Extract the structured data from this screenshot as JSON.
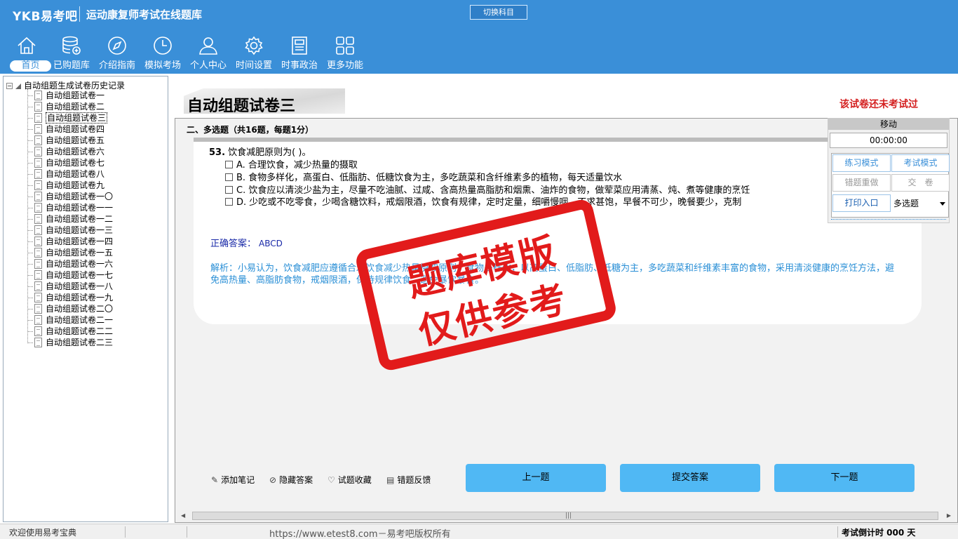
{
  "app": {
    "brand": "YKB易考吧",
    "title": "运动康复师考试在线题库",
    "switch_subject": "切换科目"
  },
  "nav": [
    {
      "label": "首页",
      "icon": "home-icon",
      "active": true
    },
    {
      "label": "已购题库",
      "icon": "database-add-icon"
    },
    {
      "label": "介绍指南",
      "icon": "compass-icon"
    },
    {
      "label": "模拟考场",
      "icon": "clock-icon"
    },
    {
      "label": "个人中心",
      "icon": "user-icon"
    },
    {
      "label": "时间设置",
      "icon": "gear-icon"
    },
    {
      "label": "时事政治",
      "icon": "newspaper-icon"
    },
    {
      "label": "更多功能",
      "icon": "grid-icon"
    }
  ],
  "tree": {
    "root": "自动组题生成试卷历史记录",
    "items": [
      "自动组题试卷一",
      "自动组题试卷二",
      "自动组题试卷三",
      "自动组题试卷四",
      "自动组题试卷五",
      "自动组题试卷六",
      "自动组题试卷七",
      "自动组题试卷八",
      "自动组题试卷九",
      "自动组题试卷一〇",
      "自动组题试卷一一",
      "自动组题试卷一二",
      "自动组题试卷一三",
      "自动组题试卷一四",
      "自动组题试卷一五",
      "自动组题试卷一六",
      "自动组题试卷一七",
      "自动组题试卷一八",
      "自动组题试卷一九",
      "自动组题试卷二〇",
      "自动组题试卷二一",
      "自动组题试卷二二",
      "自动组题试卷二三"
    ],
    "selected_index": 2
  },
  "paper": {
    "title": "自动组题试卷三",
    "status": "该试卷还未考试过",
    "section": "二、多选题（共16题，每题1分）"
  },
  "question": {
    "number": "53.",
    "stem": "饮食减肥原则为( )。",
    "options": [
      "A. 合理饮食，减少热量的摄取",
      "B. 食物多样化，高蛋白、低脂肪、低糖饮食为主，多吃蔬菜和含纤维素多的植物，每天适量饮水",
      "C. 饮食应以清淡少盐为主，尽量不吃油腻、过咸、含高热量高脂肪和烟熏、油炸的食物，做荤菜应用清蒸、炖、煮等健康的烹饪",
      "D. 少吃或不吃零食，少喝含糖饮料，戒烟限酒，饮食有规律，定时定量，细嚼慢咽，不求甚饱，早餐不可少，晚餐要少，克制"
    ],
    "answer_label": "正确答案：",
    "answer_value": "ABCD",
    "analysis": "解析：小易认为，饮食减肥应遵循合理饮食减少热量摄取原则，食物多样化，以高蛋白、低脂肪、低糖为主，多吃蔬菜和纤维素丰富的食物，采用清淡健康的烹饪方法，避免高热量、高脂肪食物，戒烟限酒，保持规律饮食，避免暴饮暴食。"
  },
  "control": {
    "move": "移动",
    "timer": "00:00:00",
    "practice_mode": "练习模式",
    "exam_mode": "考试模式",
    "redo_wrong": "错题重做",
    "submit_paper": "交　卷",
    "print_entry": "打印入口",
    "type_select": "多选题"
  },
  "tools": {
    "add_note": "添加笔记",
    "hide_answer": "隐藏答案",
    "favorite": "试题收藏",
    "feedback": "错题反馈"
  },
  "buttons": {
    "prev": "上一题",
    "submit": "提交答案",
    "next": "下一题"
  },
  "status": {
    "welcome": "欢迎使用易考宝典",
    "copyright": "https://www.etest8.com－易考吧版权所有",
    "countdown": "考试倒计时 000 天"
  },
  "watermark": {
    "line1": "题库模版",
    "line2": "仅供参考"
  },
  "colors": {
    "topbar": "#3a8fd8",
    "accent_button": "#50b8f4",
    "alert": "#d42020",
    "stamp": "#e21b1b"
  }
}
